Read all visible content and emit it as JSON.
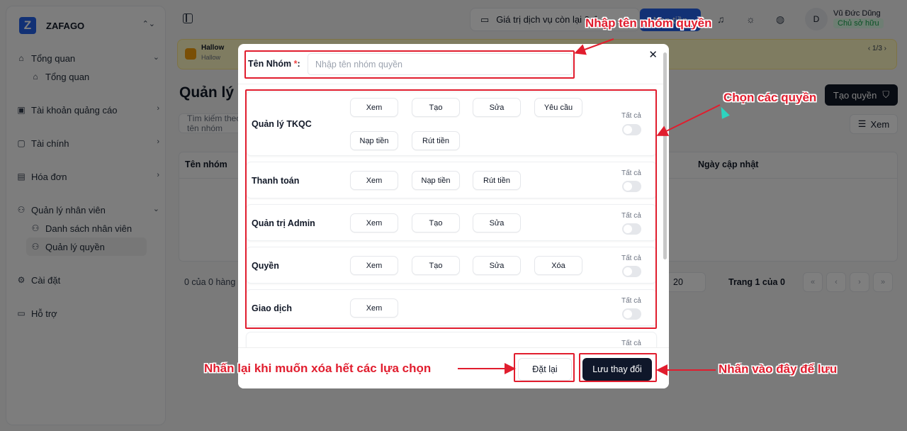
{
  "sidebar": {
    "brand": {
      "logo_letter": "Z",
      "name": "ZAFAGO"
    },
    "items": [
      {
        "label": "Tổng quan",
        "icon": "home-icon",
        "expanded": true
      },
      {
        "label": "Tổng quan",
        "icon": "home-icon",
        "sub": true
      },
      {
        "label": "Tài khoản quảng cáo",
        "icon": "box-icon"
      },
      {
        "label": "Tài chính",
        "icon": "lock-icon"
      },
      {
        "label": "Hóa đơn",
        "icon": "receipt-icon"
      },
      {
        "label": "Quản lý nhân viên",
        "icon": "users-icon",
        "expanded": true
      },
      {
        "label": "Danh sách nhân viên",
        "icon": "user-icon",
        "sub": true
      },
      {
        "label": "Quản lý quyền",
        "icon": "user-icon",
        "sub": true,
        "active": true
      },
      {
        "label": "Cài đặt",
        "icon": "gear-icon"
      },
      {
        "label": "Hỗ trợ",
        "icon": "chat-icon"
      }
    ]
  },
  "header": {
    "balance_label": "Giá trị dịch vụ còn lại",
    "balance_value": "0 đ",
    "topup_label": "Nạp tiền",
    "user_name": "Vũ Đức Dũng",
    "user_role": "Chủ sở hữu",
    "avatar_letter": "D"
  },
  "banner": {
    "title": "Hallow",
    "subtitle": "Hallow",
    "counter": "1/3"
  },
  "main": {
    "title": "Quản lý quyền",
    "create_button": "Tạo quyền",
    "search_placeholder": "Tìm kiếm theo tên nhóm",
    "view_button": "Xem",
    "table_headers": [
      "Tên nhóm",
      "Ngày cập nhật"
    ],
    "rows_info": "0 của 0 hàng được chọn",
    "page_size": "20",
    "page_info": "Trang 1 của 0"
  },
  "modal": {
    "name_label": "Tên Nhóm",
    "name_required": "*",
    "name_colon": ":",
    "name_placeholder": "Nhập tên nhóm quyền",
    "all_label": "Tất cả",
    "groups": [
      {
        "name": "Quản lý TKQC",
        "actions": [
          "Xem",
          "Tạo",
          "Sửa",
          "Yêu cầu",
          "Nạp tiền",
          "Rút tiền"
        ]
      },
      {
        "name": "Thanh toán",
        "actions": [
          "Xem",
          "Nạp tiền",
          "Rút tiền"
        ]
      },
      {
        "name": "Quản trị Admin",
        "actions": [
          "Xem",
          "Tạo",
          "Sửa"
        ]
      },
      {
        "name": "Quyền",
        "actions": [
          "Xem",
          "Tạo",
          "Sửa",
          "Xóa"
        ]
      },
      {
        "name": "Giao dịch",
        "actions": [
          "Xem"
        ]
      }
    ],
    "reset_button": "Đặt lại",
    "save_button": "Lưu thay đổi"
  },
  "annotations": {
    "name_note": "Nhập tên nhóm quyền",
    "permissions_note": "Chọn các quyền",
    "reset_note": "Nhấn lại khi muốn xóa hết các lựa chọn",
    "save_note": "Nhấn vào đây để lưu",
    "color": "#e11d2e"
  }
}
